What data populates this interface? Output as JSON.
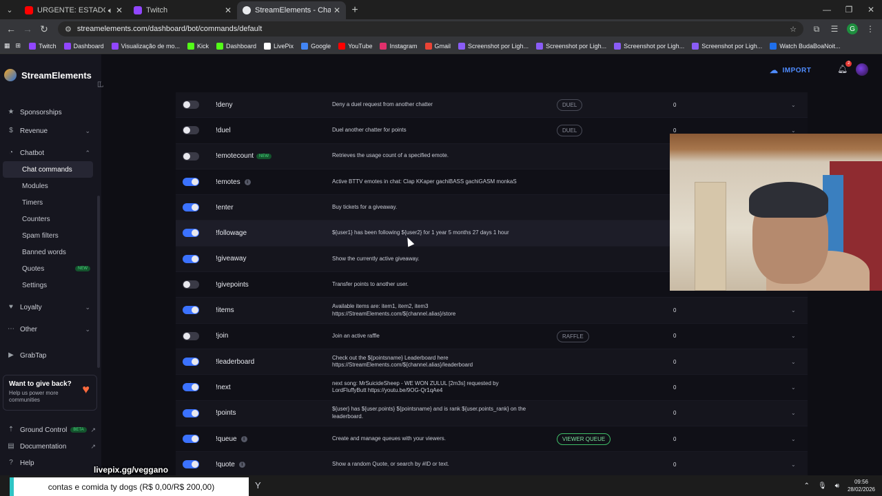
{
  "browser": {
    "tabs": [
      {
        "title": "URGENTE: ESTADOS UNIDOS",
        "favicon_color": "#ff0000",
        "muted_icon": "speaker-icon"
      },
      {
        "title": "Twitch",
        "favicon_color": "#9146ff"
      },
      {
        "title": "StreamElements - Chat comma",
        "favicon_color": "#e8eaed"
      }
    ],
    "url": "streamelements.com/dashboard/bot/commands/default",
    "profile_initial": "G"
  },
  "bookmarks": [
    {
      "label": "Twitch",
      "color": "#9146ff"
    },
    {
      "label": "Dashboard",
      "color": "#9146ff"
    },
    {
      "label": "Visualização de mo...",
      "color": "#9146ff"
    },
    {
      "label": "Kick",
      "color": "#53fc18"
    },
    {
      "label": "Dashboard",
      "color": "#53fc18"
    },
    {
      "label": "LivePix",
      "color": "#ffffff"
    },
    {
      "label": "Google",
      "color": "#4285f4"
    },
    {
      "label": "YouTube",
      "color": "#ff0000"
    },
    {
      "label": "Instagram",
      "color": "#e1306c"
    },
    {
      "label": "Gmail",
      "color": "#ea4335"
    },
    {
      "label": "Screenshot por Ligh...",
      "color": "#8a5cf6"
    },
    {
      "label": "Screenshot por Ligh...",
      "color": "#8a5cf6"
    },
    {
      "label": "Screenshot por Ligh...",
      "color": "#8a5cf6"
    },
    {
      "label": "Screenshot por Ligh...",
      "color": "#8a5cf6"
    },
    {
      "label": "Watch BudaBoaNoit...",
      "color": "#1f6feb"
    }
  ],
  "brand": "StreamElements",
  "header": {
    "import_label": "IMPORT",
    "notification_count": "2"
  },
  "sidebar": {
    "items": [
      {
        "label": "Sponsorships",
        "icon": "star-icon"
      },
      {
        "label": "Revenue",
        "icon": "dollar-icon",
        "chevron": "down"
      },
      {
        "label": "Chatbot",
        "icon": "chat-icon",
        "chevron": "up"
      }
    ],
    "chatbot_sub": [
      {
        "label": "Chat commands",
        "active": true
      },
      {
        "label": "Modules"
      },
      {
        "label": "Timers"
      },
      {
        "label": "Counters"
      },
      {
        "label": "Spam filters"
      },
      {
        "label": "Banned words"
      },
      {
        "label": "Quotes",
        "badge": "NEW"
      },
      {
        "label": "Settings"
      }
    ],
    "more": [
      {
        "label": "Loyalty",
        "icon": "heart-icon"
      },
      {
        "label": "Other",
        "icon": "dots-icon"
      },
      {
        "label": "GrabTap",
        "icon": "grabtap-icon"
      }
    ],
    "give_back": {
      "title": "Want to give back?",
      "desc": "Help us power more communities"
    },
    "bottom": [
      {
        "label": "Ground Control",
        "badge": "BETA"
      },
      {
        "label": "Documentation"
      },
      {
        "label": "Help"
      }
    ]
  },
  "commands": [
    {
      "name": "!deny",
      "enabled": false,
      "desc": [
        "Deny a duel request from another chatter"
      ],
      "category": "DUEL",
      "cost": "0"
    },
    {
      "name": "!duel",
      "enabled": false,
      "desc": [
        "Duel another chatter for points"
      ],
      "category": "DUEL",
      "cost": "0"
    },
    {
      "name": "!emotecount",
      "enabled": false,
      "tag": "NEW",
      "desc": [
        "Retrieves the usage count of a specified emote."
      ]
    },
    {
      "name": "!emotes",
      "enabled": true,
      "info": true,
      "desc": [
        "Active BTTV emotes in chat: Clap KKaper gachiBASS gachiGASM monkaS"
      ]
    },
    {
      "name": "!enter",
      "enabled": true,
      "desc": [
        "Buy tickets for a giveaway."
      ]
    },
    {
      "name": "!followage",
      "enabled": true,
      "desc": [
        "${user1} has been following ${user2} for 1 year 5 months 27 days 1 hour"
      ]
    },
    {
      "name": "!giveaway",
      "enabled": true,
      "desc": [
        "Show the currently active giveaway."
      ]
    },
    {
      "name": "!givepoints",
      "enabled": false,
      "desc": [
        "Transfer points to another user."
      ]
    },
    {
      "name": "!items",
      "enabled": true,
      "desc": [
        "Available items are: item1, item2, item3",
        "https://StreamElements.com/${channel.alias}/store"
      ],
      "cost": "0"
    },
    {
      "name": "!join",
      "enabled": false,
      "desc": [
        "Join an active raffle"
      ],
      "category": "RAFFLE",
      "cost": "0"
    },
    {
      "name": "!leaderboard",
      "enabled": true,
      "desc": [
        "Check out the ${pointsname} Leaderboard here",
        "https://StreamElements.com/${channel.alias}/leaderboard"
      ],
      "cost": "0"
    },
    {
      "name": "!next",
      "enabled": true,
      "desc": [
        "next song: MrSuicideSheep - WE WON ZULUL [2m3s] requested by",
        "LordFluffyButt https://youtu.be/9OG-Qr1qAe4"
      ],
      "cost": "0"
    },
    {
      "name": "!points",
      "enabled": true,
      "desc": [
        "${user} has ${user.points} ${pointsname} and is rank ${user.points_rank} on the",
        "leaderboard."
      ],
      "cost": "0"
    },
    {
      "name": "!queue",
      "enabled": true,
      "info": true,
      "desc": [
        "Create and manage queues with your viewers."
      ],
      "category": "VIEWER QUEUE",
      "category_style": "green",
      "cost": "0"
    },
    {
      "name": "!quote",
      "enabled": true,
      "info": true,
      "desc": [
        "Show a random Quote, or search by #ID or text."
      ],
      "cost": "0"
    }
  ],
  "overlay": {
    "livepix": "livepix.gg/veggano",
    "ticker": "contas e comida ty dogs (R$ 0,00/R$ 200,00)"
  },
  "taskbar": {
    "time": "09:56",
    "date": "28/02/2026"
  }
}
